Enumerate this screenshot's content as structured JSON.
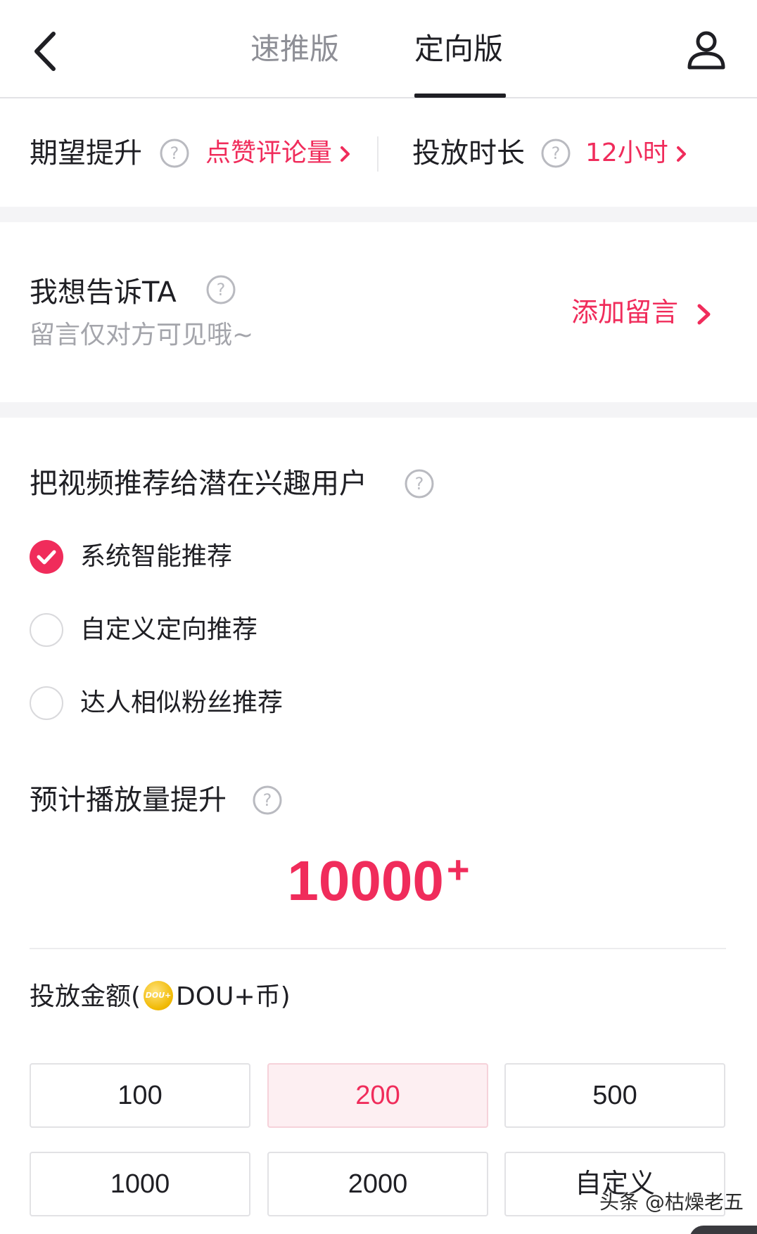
{
  "header": {
    "tabs": [
      {
        "label": "速推版",
        "active": false
      },
      {
        "label": "定向版",
        "active": true
      }
    ],
    "icons": {
      "back": "chevron-left-icon",
      "user": "user-icon",
      "help": "question-circle-icon",
      "coin": "dou-coin-icon"
    },
    "coin_text": "DOU+"
  },
  "settings": {
    "expect_label": "期望提升",
    "expect_value": "点赞评论量",
    "duration_label": "投放时长",
    "duration_value": "12小时"
  },
  "message": {
    "title": "我想告诉TA",
    "subtitle": "留言仅对方可见哦~",
    "action": "添加留言"
  },
  "targeting": {
    "title": "把视频推荐给潜在兴趣用户",
    "options": [
      {
        "label": "系统智能推荐",
        "selected": true
      },
      {
        "label": "自定义定向推荐",
        "selected": false
      },
      {
        "label": "达人相似粉丝推荐",
        "selected": false
      }
    ]
  },
  "estimate": {
    "title": "预计播放量提升",
    "value": "10000",
    "suffix": "+"
  },
  "amount": {
    "title_prefix": "投放金额(",
    "title_suffix": "DOU+币)",
    "options": [
      {
        "label": "100",
        "selected": false
      },
      {
        "label": "200",
        "selected": true
      },
      {
        "label": "500",
        "selected": false
      },
      {
        "label": "1000",
        "selected": false
      },
      {
        "label": "2000",
        "selected": false
      },
      {
        "label": "自定义",
        "selected": false
      }
    ]
  },
  "watermark": "头条 @枯燥老五",
  "colors": {
    "accent": "#f02c5b",
    "text": "#1f1f24",
    "muted": "#8e8f96",
    "selected_bg": "#fdeff2"
  }
}
